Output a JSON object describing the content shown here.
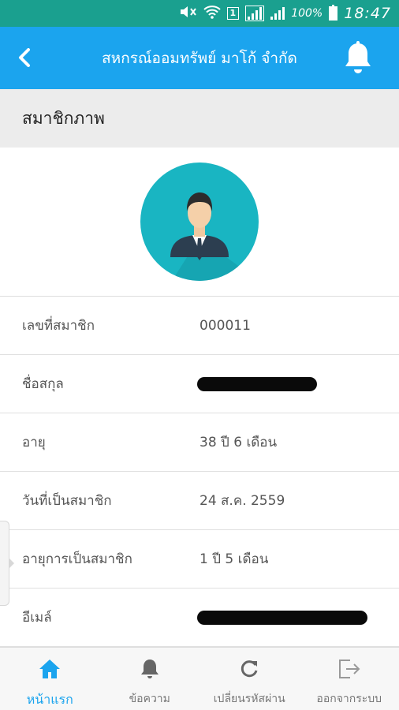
{
  "status_bar": {
    "sim": "1",
    "battery": "100%",
    "time": "18:47"
  },
  "app_bar": {
    "title": "สหกรณ์ออมทรัพย์ มาโก้ จำกัด"
  },
  "section": {
    "title": "สมาชิกภาพ"
  },
  "profile": {
    "rows": [
      {
        "label": "เลขที่สมาชิก",
        "value": "000011"
      },
      {
        "label": "ชื่อสกุล",
        "value": ""
      },
      {
        "label": "อายุ",
        "value": "38  ปี  6  เดือน"
      },
      {
        "label": "วันที่เป็นสมาชิก",
        "value": "24  ส.ค.  2559"
      },
      {
        "label": "อายุการเป็นสมาชิก",
        "value": "1  ปี  5  เดือน"
      },
      {
        "label": "อีเมล์",
        "value": ""
      }
    ]
  },
  "bottom_nav": {
    "items": [
      {
        "label": "หน้าแรก",
        "icon": "home-icon"
      },
      {
        "label": "ข้อความ",
        "icon": "bell-icon"
      },
      {
        "label": "เปลี่ยนรหัสผ่าน",
        "icon": "refresh-icon"
      },
      {
        "label": "ออกจากระบบ",
        "icon": "logout-icon"
      }
    ]
  },
  "colors": {
    "status_bar": "#1aa08f",
    "app_bar": "#1ba4ee",
    "avatar_bg": "#19b5c2",
    "active_nav": "#1ba4ee"
  }
}
